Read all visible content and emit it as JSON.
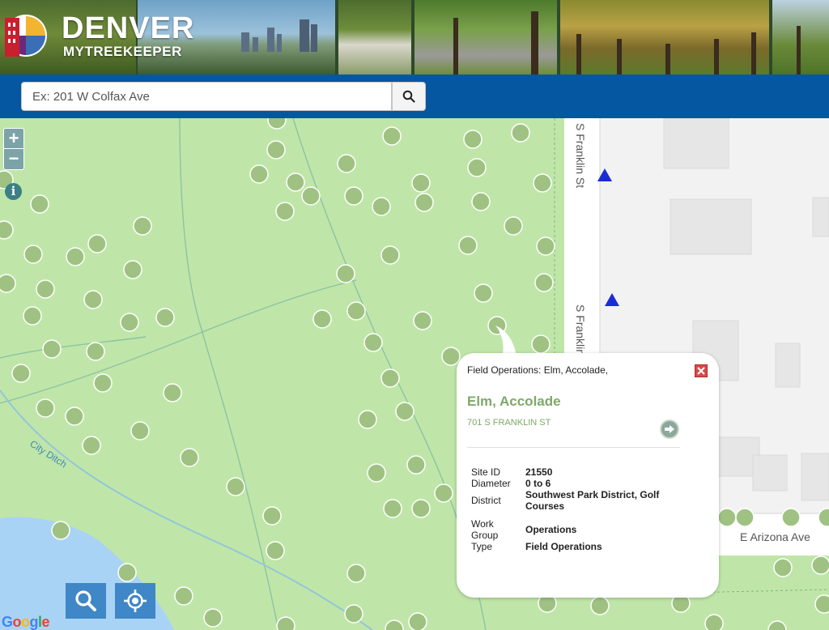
{
  "header": {
    "logo_title": "DENVER",
    "logo_subtitle": "MYTREEKEEPER"
  },
  "search": {
    "placeholder": "Ex: 201 W Colfax Ave",
    "button_icon": "search-icon"
  },
  "map": {
    "street_labels": {
      "franklin_north": "S Franklin St",
      "franklin_south": "S Franklin St",
      "arizona": "E Arizona Ave",
      "ditch": "City Ditch"
    },
    "attribution": "Google",
    "colors": {
      "park": "#bfe6a8",
      "tree_fill": "#9fc282",
      "tree_stroke": "#ffffff",
      "marker": "#1a2bd6",
      "water": "#a9d3f5"
    }
  },
  "controls": {
    "zoom_in": "+",
    "zoom_out": "−",
    "info": "i"
  },
  "popup": {
    "header": "Field Operations: Elm, Accolade,",
    "title": "Elm, Accolade",
    "address": "701 S FRANKLIN ST",
    "fields": [
      {
        "label": "Site ID",
        "value": "21550"
      },
      {
        "label": "Diameter",
        "value": "0 to 6"
      },
      {
        "label": "District",
        "value": "Southwest Park District, Golf Courses"
      },
      {
        "label": "Work Group",
        "value": "Operations"
      },
      {
        "label": "Type",
        "value": "Field Operations"
      }
    ]
  }
}
